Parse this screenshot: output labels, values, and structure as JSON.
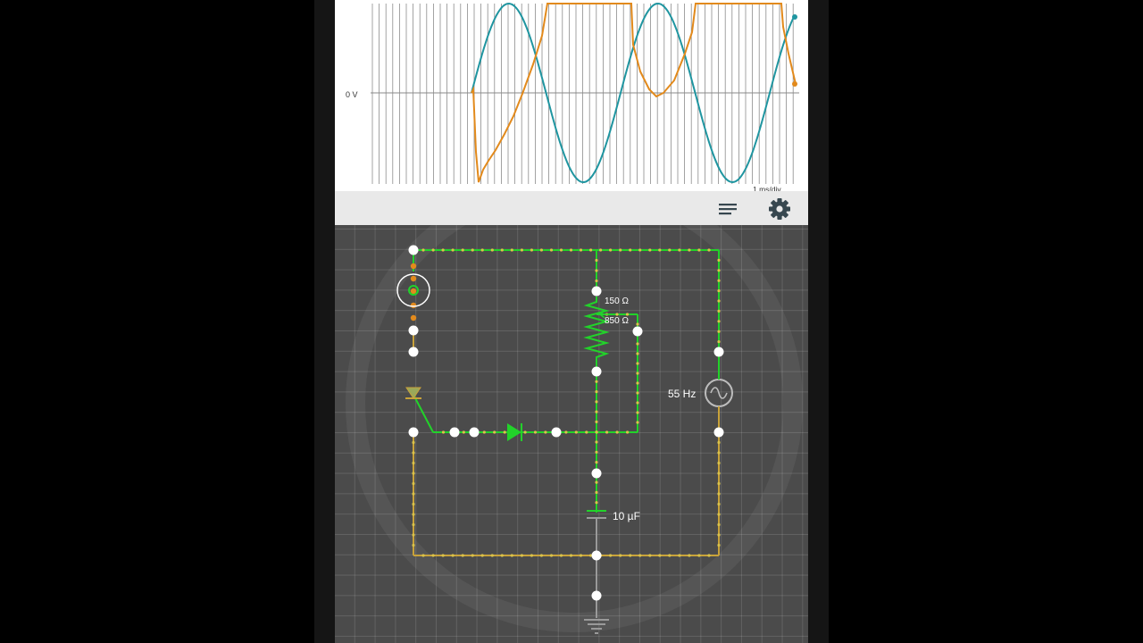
{
  "oscilloscope": {
    "zero_label": "0 V",
    "timebase_label": "1 ms/div",
    "trace_colors": {
      "voltage": "#e28a1c",
      "source": "#1f95a0"
    }
  },
  "toolbar": {
    "menu_icon": "lines-menu-icon",
    "settings_icon": "gear-icon"
  },
  "circuit": {
    "resistor_upper": "150 Ω",
    "resistor_lower": "850 Ω",
    "source_freq": "55 Hz",
    "capacitor": "10 µF",
    "wire_color": "#22d22a",
    "dim_wire_color": "#c8a23a",
    "node_color": "#ffffff"
  }
}
